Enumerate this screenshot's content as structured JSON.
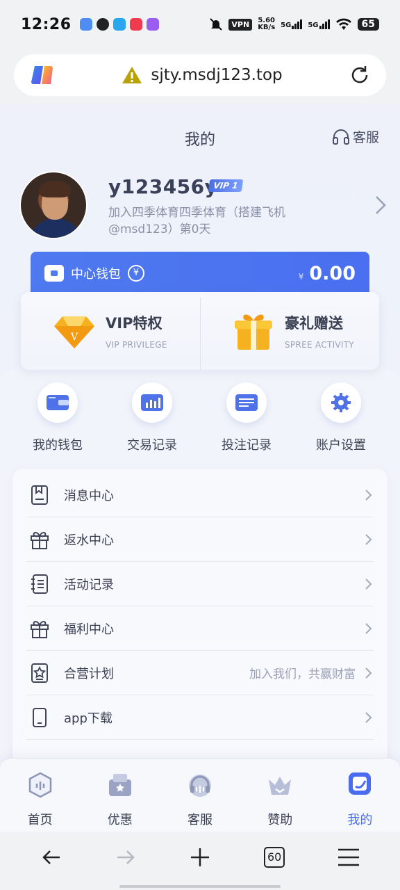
{
  "status_bar": {
    "time": "12:26",
    "vpn": "VPN",
    "net_speed_value": "5.60",
    "net_speed_unit": "KB/s",
    "signal_1": "5G",
    "signal_2": "5G",
    "battery": "65"
  },
  "address_bar": {
    "url": "sjty.msdj123.top"
  },
  "header": {
    "title": "我的",
    "customer_service": "客服"
  },
  "profile": {
    "username": "y123456y",
    "vip_level": "VIP 1",
    "description": "加入四季体育四季体育（搭建飞机@msd123）第0天"
  },
  "wallet": {
    "label": "中心钱包",
    "currency": "¥",
    "amount": "0.00"
  },
  "privileges": [
    {
      "title": "VIP特权",
      "subtitle": "VIP PRIVILEGE"
    },
    {
      "title": "豪礼赠送",
      "subtitle": "SPREE ACTIVITY"
    }
  ],
  "quick_actions": [
    {
      "label": "我的钱包",
      "icon": "wallet-icon"
    },
    {
      "label": "交易记录",
      "icon": "transaction-icon"
    },
    {
      "label": "投注记录",
      "icon": "bet-record-icon"
    },
    {
      "label": "账户设置",
      "icon": "gear-icon"
    }
  ],
  "menu": [
    {
      "label": "消息中心",
      "hint": "",
      "icon": "message-icon"
    },
    {
      "label": "返水中心",
      "hint": "",
      "icon": "gift-icon"
    },
    {
      "label": "活动记录",
      "hint": "",
      "icon": "notebook-icon"
    },
    {
      "label": "福利中心",
      "hint": "",
      "icon": "gift-icon"
    },
    {
      "label": "合营计划",
      "hint": "加入我们，共赢财富",
      "icon": "star-badge-icon"
    },
    {
      "label": "app下载",
      "hint": "",
      "icon": "phone-icon"
    }
  ],
  "tabs": [
    {
      "label": "首页",
      "icon": "home-icon"
    },
    {
      "label": "优惠",
      "icon": "coupon-icon"
    },
    {
      "label": "客服",
      "icon": "headset-icon"
    },
    {
      "label": "赞助",
      "icon": "crown-icon"
    },
    {
      "label": "我的",
      "icon": "profile-icon",
      "active": true
    }
  ],
  "browser": {
    "tab_count": "60"
  },
  "colors": {
    "accent": "#4a6cf0",
    "wallet_bg": "#4e79ef",
    "gold": "#f5b120"
  }
}
